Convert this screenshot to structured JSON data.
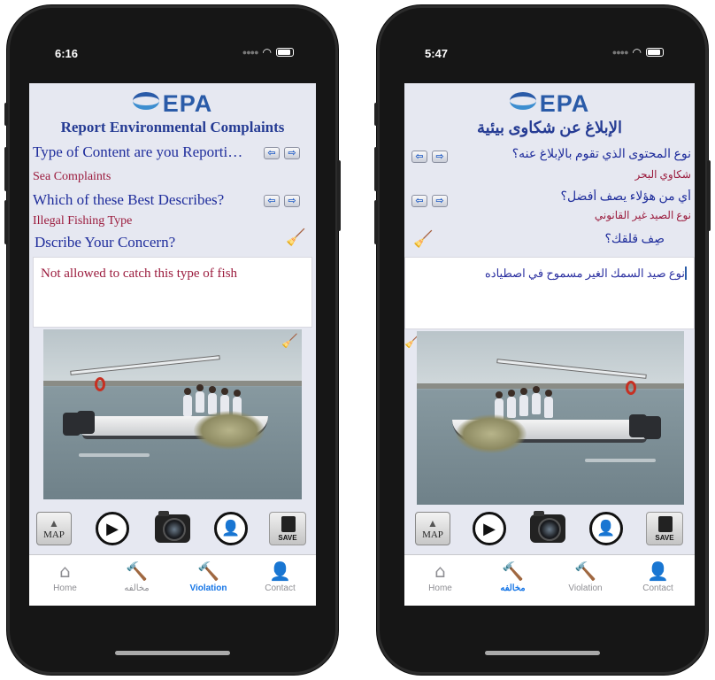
{
  "left_phone": {
    "status_time": "6:16",
    "logo_text": "EPA",
    "title": "Report Environmental Complaints",
    "question1": "Type of Content are you Reporti…",
    "answer1": "Sea Complaints",
    "question2": "Which of these Best Describes?",
    "answer2": "Illegal Fishing Type",
    "question3": "Dscribe Your Concern?",
    "concern_text": "Not allowed to catch this type of fish",
    "toolbar": {
      "map_label": "MAP",
      "save_label": "SAVE"
    },
    "tabs": [
      {
        "label": "Home",
        "icon": "home-icon",
        "active": false
      },
      {
        "label": "مخالفه",
        "icon": "gavel-icon",
        "active": false
      },
      {
        "label": "Violation",
        "icon": "gavel-icon",
        "active": true
      },
      {
        "label": "Contact",
        "icon": "person-icon",
        "active": false
      }
    ]
  },
  "right_phone": {
    "status_time": "5:47",
    "logo_text": "EPA",
    "title": "الإبلاغ عن شكاوى بيئية",
    "question1": "نوع المحتوى الذي تقوم بالإبلاغ عنه؟",
    "answer1": "شكاوي البحر",
    "question2": "أي من هؤلاء يصف أفضل؟",
    "answer2": "نوع الصيد غير القانوني",
    "question3": "صِف قلقك؟",
    "concern_text": "نوع صيد السمك الغير مسموح في اصطياده",
    "toolbar": {
      "map_label": "MAP",
      "save_label": "SAVE"
    },
    "tabs": [
      {
        "label": "Home",
        "icon": "home-icon",
        "active": false
      },
      {
        "label": "مخالفه",
        "icon": "gavel-icon",
        "active": true
      },
      {
        "label": "Violation",
        "icon": "gavel-icon",
        "active": false
      },
      {
        "label": "Contact",
        "icon": "person-icon",
        "active": false
      }
    ]
  },
  "colors": {
    "accent_blue": "#1575e6",
    "title_navy": "#263c94",
    "answer_red": "#9b1b3d",
    "screen_bg": "#e6e8f1"
  },
  "arrow_left": "⇦",
  "arrow_right": "⇨"
}
